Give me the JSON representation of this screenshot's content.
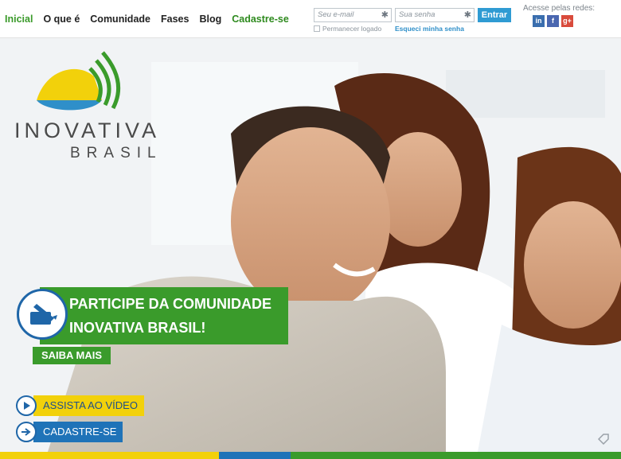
{
  "nav": {
    "items": [
      {
        "label": "Inicial"
      },
      {
        "label": "O que é"
      },
      {
        "label": "Comunidade"
      },
      {
        "label": "Fases"
      },
      {
        "label": "Blog"
      },
      {
        "label": "Cadastre-se"
      }
    ]
  },
  "login": {
    "email_placeholder": "Seu e-mail",
    "password_placeholder": "Sua senha",
    "submit_label": "Entrar",
    "remember_label": "Permanecer logado",
    "forgot_label": "Esqueci minha senha"
  },
  "social": {
    "label": "Acesse pelas redes:",
    "icons": [
      "linkedin-icon",
      "facebook-icon",
      "google-plus-icon"
    ]
  },
  "hero": {
    "logo_word": "INOVATIVA",
    "logo_sub": "BRASIL",
    "banner_line1": "PARTICIPE DA COMUNIDADE",
    "banner_line2": "INOVATIVA BRASIL!",
    "saiba_mais": "SAIBA MAIS",
    "video_label": "ASSISTA AO VÍDEO",
    "cadastre_label": "CADASTRE-SE"
  },
  "colors": {
    "green": "#3a9b2b",
    "blue": "#1f73b8",
    "yellow": "#f2d10b",
    "accent_blue": "#2f9bd3"
  }
}
